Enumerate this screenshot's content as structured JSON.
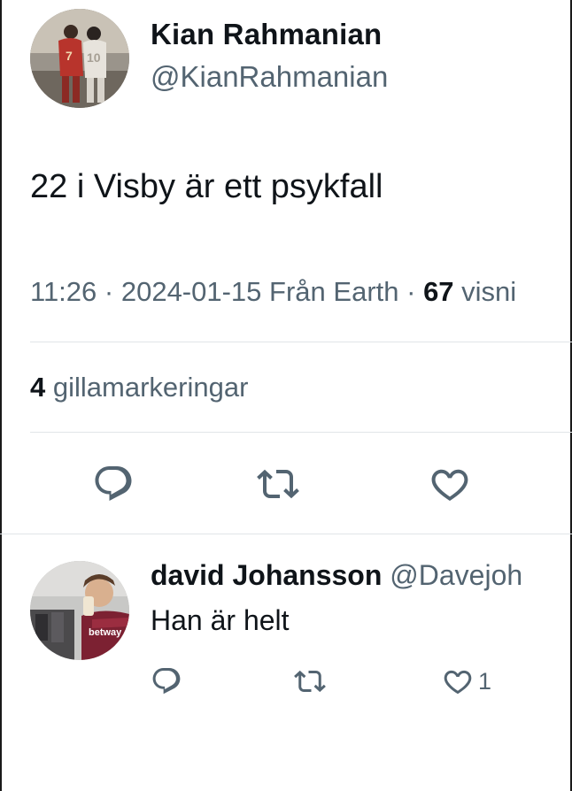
{
  "tweet": {
    "author_name": "Kian Rahmanian",
    "author_handle": "@KianRahmanian",
    "text": "22 i Visby är ett psykfall",
    "time": "11:26",
    "date": "2024-01-15",
    "location": "Från Earth",
    "views_count": "67",
    "views_label": "visni",
    "likes_count": "4",
    "likes_label": "gillamarkeringar",
    "actions": {
      "reply_icon": "reply-icon",
      "retweet_icon": "retweet-icon",
      "like_icon": "like-icon"
    }
  },
  "reply": {
    "author_name": "david Johansson",
    "author_handle": "@Davejoh",
    "text": "Han är helt",
    "like_count": "1"
  },
  "colors": {
    "text_primary": "#0f1419",
    "text_secondary": "#536471",
    "divider": "#e1e5e8",
    "background": "#ffffff"
  }
}
